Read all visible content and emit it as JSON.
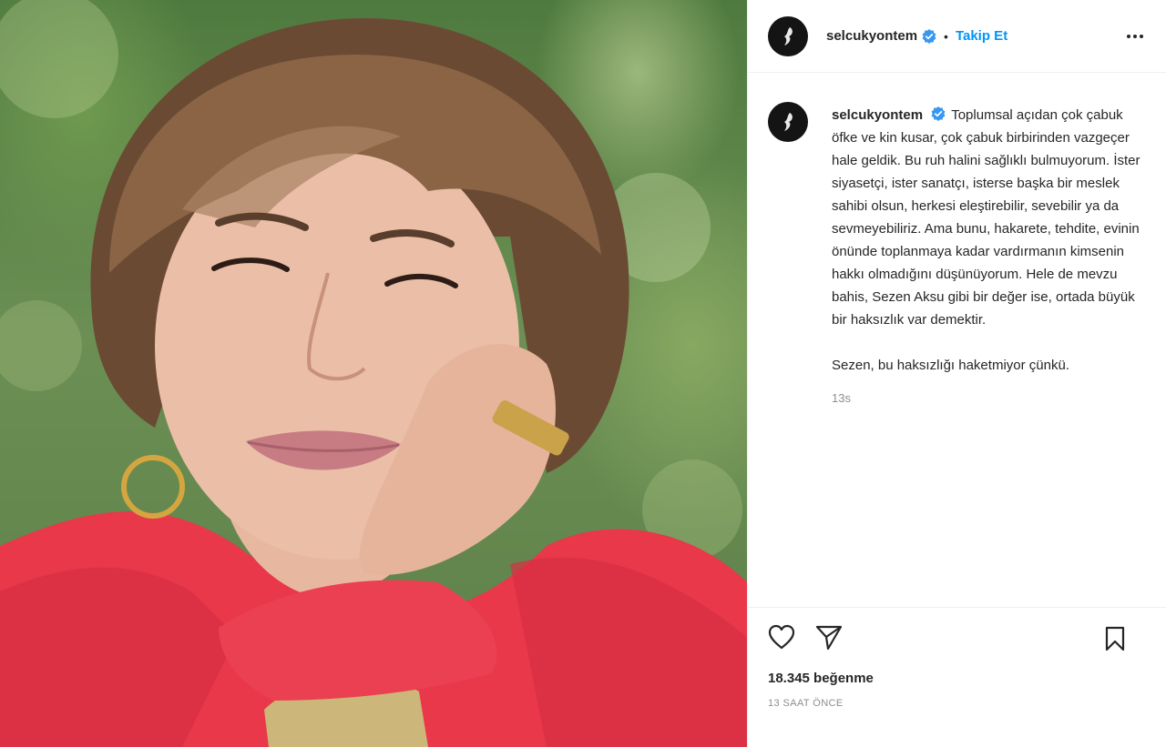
{
  "post": {
    "username": "selcukyontem",
    "follow_label": "Takip Et",
    "separator": "•",
    "caption_paragraph_1": "Toplumsal açıdan çok çabuk öfke ve kin kusar, çok çabuk birbirinden vazgeçer hale geldik. Bu ruh halini sağlıklı bulmuyorum. İster siyasetçi, ister sanatçı, isterse başka bir meslek sahibi olsun, herkesi eleştirebilir, sevebilir ya da sevmeyebiliriz. Ama bunu, hakarete, tehdite, evinin önünde toplanmaya kadar vardırmanın kimsenin hakkı olmadığını düşünüyorum. Hele de mevzu bahis, Sezen Aksu gibi bir değer ise, ortada büyük bir haksızlık var demektir.",
    "caption_paragraph_2": "Sezen, bu haksızlığı haketmiyor çünkü.",
    "comment_time": "13s",
    "likes": "18.345 beğenme",
    "posted_ago": "13 SAAT ÖNCE"
  },
  "icons": {
    "verified": "verified-badge-icon",
    "more": "more-options-icon",
    "like": "heart-icon",
    "share": "paper-plane-icon",
    "save": "bookmark-icon"
  },
  "colors": {
    "link_blue": "#0095f6",
    "verified_blue": "#3897f0",
    "text": "#262626",
    "muted": "#8e8e8e",
    "divider": "#efefef"
  }
}
